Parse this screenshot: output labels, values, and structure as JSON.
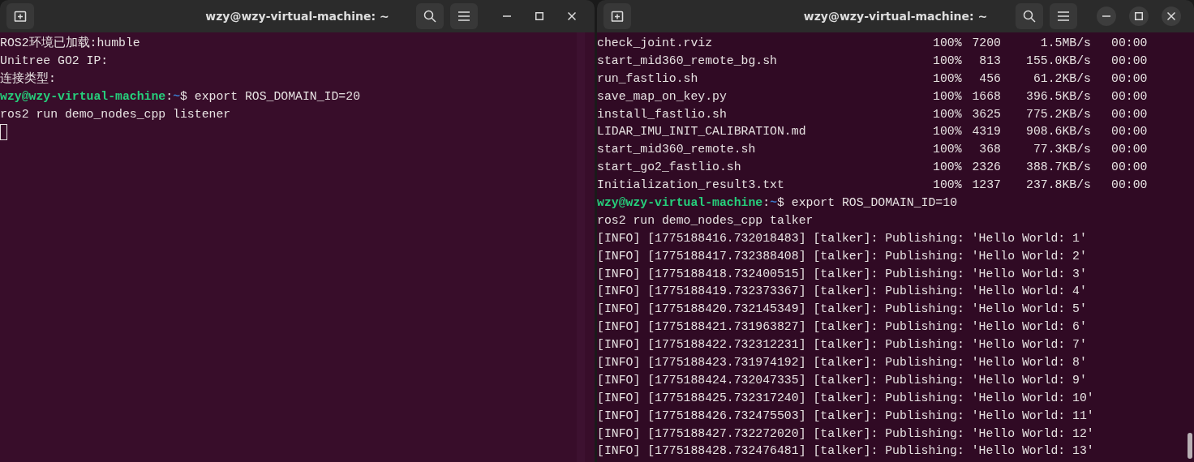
{
  "windows": [
    {
      "title": "wzy@wzy-virtual-machine: ~",
      "focused": false,
      "lines": [
        {
          "kind": "output",
          "text": "ROS2环境已加载:humble"
        },
        {
          "kind": "output",
          "text": "Unitree GO2 IP:"
        },
        {
          "kind": "output",
          "text": "连接类型:"
        },
        {
          "kind": "prompt",
          "user_host": "wzy@wzy-virtual-machine",
          "separator": ":",
          "path": "~",
          "symbol": "$",
          "command": "export ROS_DOMAIN_ID=20"
        },
        {
          "kind": "output",
          "text": "ros2 run demo_nodes_cpp listener"
        },
        {
          "kind": "cursor"
        }
      ]
    },
    {
      "title": "wzy@wzy-virtual-machine: ~",
      "focused": true,
      "lines": [
        {
          "kind": "transfer",
          "file": "check_joint.rviz",
          "percent": "100%",
          "size": "7200",
          "rate": "1.5MB/s",
          "eta": "00:00"
        },
        {
          "kind": "transfer",
          "file": "start_mid360_remote_bg.sh",
          "percent": "100%",
          "size": "813",
          "rate": "155.0KB/s",
          "eta": "00:00"
        },
        {
          "kind": "transfer",
          "file": "run_fastlio.sh",
          "percent": "100%",
          "size": "456",
          "rate": "61.2KB/s",
          "eta": "00:00"
        },
        {
          "kind": "transfer",
          "file": "save_map_on_key.py",
          "percent": "100%",
          "size": "1668",
          "rate": "396.5KB/s",
          "eta": "00:00"
        },
        {
          "kind": "transfer",
          "file": "install_fastlio.sh",
          "percent": "100%",
          "size": "3625",
          "rate": "775.2KB/s",
          "eta": "00:00"
        },
        {
          "kind": "transfer",
          "file": "LIDAR_IMU_INIT_CALIBRATION.md",
          "percent": "100%",
          "size": "4319",
          "rate": "908.6KB/s",
          "eta": "00:00"
        },
        {
          "kind": "transfer",
          "file": "start_mid360_remote.sh",
          "percent": "100%",
          "size": "368",
          "rate": "77.3KB/s",
          "eta": "00:00"
        },
        {
          "kind": "transfer",
          "file": "start_go2_fastlio.sh",
          "percent": "100%",
          "size": "2326",
          "rate": "388.7KB/s",
          "eta": "00:00"
        },
        {
          "kind": "transfer",
          "file": "Initialization_result3.txt",
          "percent": "100%",
          "size": "1237",
          "rate": "237.8KB/s",
          "eta": "00:00"
        },
        {
          "kind": "prompt",
          "user_host": "wzy@wzy-virtual-machine",
          "separator": ":",
          "path": "~",
          "symbol": "$",
          "command": "export ROS_DOMAIN_ID=10"
        },
        {
          "kind": "output",
          "text": "ros2 run demo_nodes_cpp talker"
        },
        {
          "kind": "output",
          "text": "[INFO] [1775188416.732018483] [talker]: Publishing: 'Hello World: 1'"
        },
        {
          "kind": "output",
          "text": "[INFO] [1775188417.732388408] [talker]: Publishing: 'Hello World: 2'"
        },
        {
          "kind": "output",
          "text": "[INFO] [1775188418.732400515] [talker]: Publishing: 'Hello World: 3'"
        },
        {
          "kind": "output",
          "text": "[INFO] [1775188419.732373367] [talker]: Publishing: 'Hello World: 4'"
        },
        {
          "kind": "output",
          "text": "[INFO] [1775188420.732145349] [talker]: Publishing: 'Hello World: 5'"
        },
        {
          "kind": "output",
          "text": "[INFO] [1775188421.731963827] [talker]: Publishing: 'Hello World: 6'"
        },
        {
          "kind": "output",
          "text": "[INFO] [1775188422.732312231] [talker]: Publishing: 'Hello World: 7'"
        },
        {
          "kind": "output",
          "text": "[INFO] [1775188423.731974192] [talker]: Publishing: 'Hello World: 8'"
        },
        {
          "kind": "output",
          "text": "[INFO] [1775188424.732047335] [talker]: Publishing: 'Hello World: 9'"
        },
        {
          "kind": "output",
          "text": "[INFO] [1775188425.732317240] [talker]: Publishing: 'Hello World: 10'"
        },
        {
          "kind": "output",
          "text": "[INFO] [1775188426.732475503] [talker]: Publishing: 'Hello World: 11'"
        },
        {
          "kind": "output",
          "text": "[INFO] [1775188427.732272020] [talker]: Publishing: 'Hello World: 12'"
        },
        {
          "kind": "output",
          "text": "[INFO] [1775188428.732476481] [talker]: Publishing: 'Hello World: 13'"
        }
      ]
    }
  ]
}
